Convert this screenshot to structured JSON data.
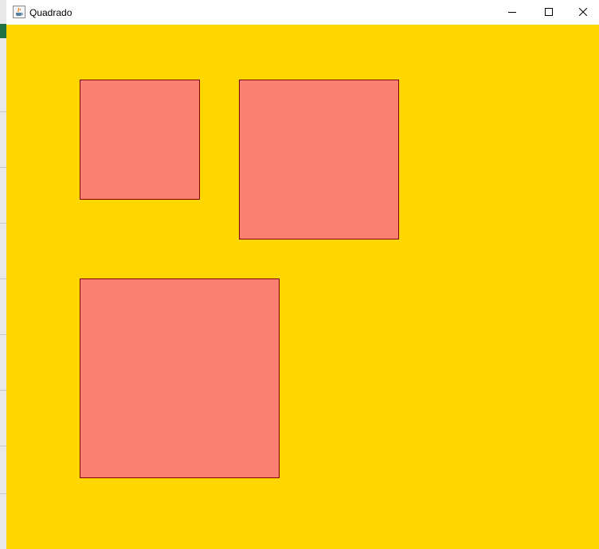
{
  "window": {
    "title": "Quadrado",
    "app_icon": "java-cup-icon",
    "controls": {
      "minimize_icon": "minimize-icon",
      "maximize_icon": "maximize-icon",
      "close_icon": "close-icon"
    }
  },
  "canvas": {
    "background_color": "#FFD700",
    "square_fill_color": "#FA8072",
    "square_border_color": "#8B0000"
  }
}
